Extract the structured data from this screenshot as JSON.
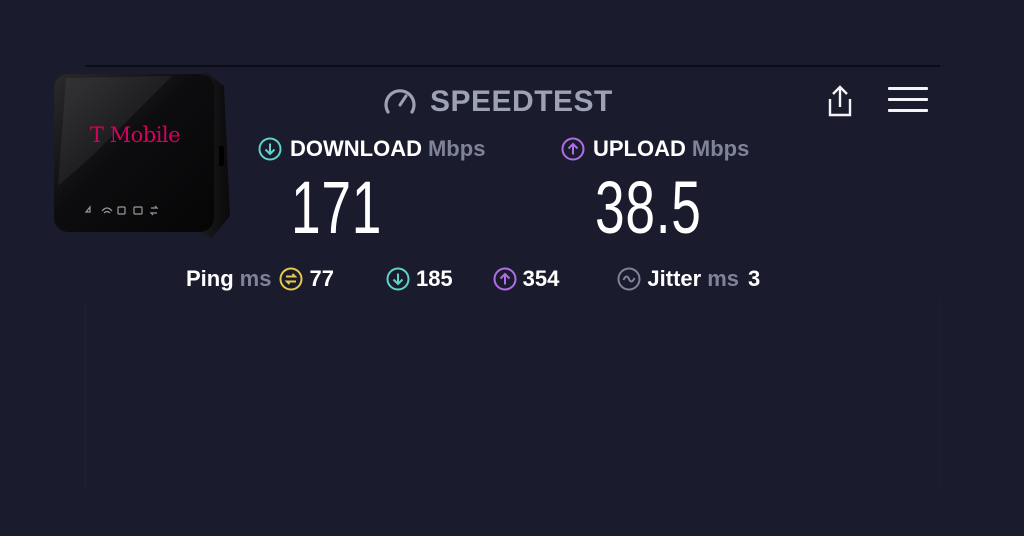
{
  "header": {
    "app_title": "SPEEDTEST",
    "icons": {
      "logo": "speedometer-gauge-icon",
      "share": "share-upload-icon",
      "menu": "hamburger-menu-icon"
    }
  },
  "device": {
    "brand": "T Mobile",
    "icon": "mobile-hotspot-device-image"
  },
  "download": {
    "label": "DOWNLOAD",
    "unit": "Mbps",
    "value": "171",
    "icon": "arrow-down-circle-icon",
    "color": "#5fd3c9"
  },
  "upload": {
    "label": "UPLOAD",
    "unit": "Mbps",
    "value": "38.5",
    "icon": "arrow-up-circle-icon",
    "color": "#b06ee6"
  },
  "ping": {
    "label": "Ping",
    "unit": "ms",
    "idle_value": "77",
    "idle_icon": "idle-latency-icon",
    "idle_color": "#e6c84b",
    "download_value": "185",
    "upload_value": "354",
    "jitter_label": "Jitter",
    "jitter_unit": "ms",
    "jitter_value": "3",
    "jitter_icon": "jitter-wave-icon"
  },
  "colors": {
    "background": "#1b1b2e",
    "muted_text": "#7f8397",
    "brand_magenta": "#d6005f"
  }
}
